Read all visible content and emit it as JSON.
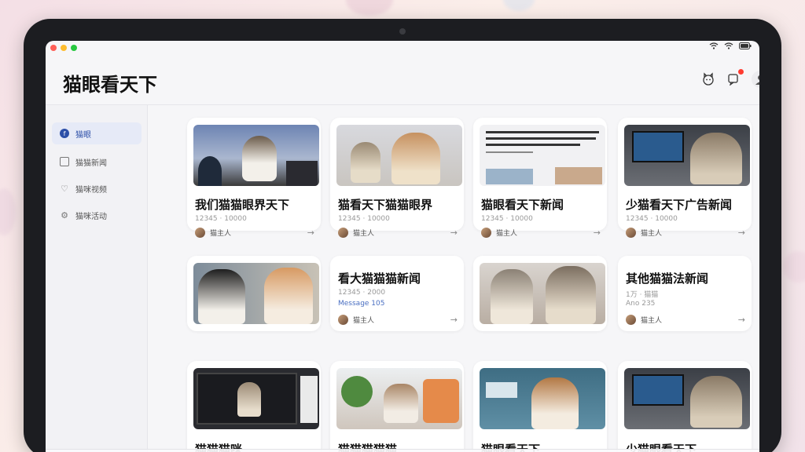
{
  "app": {
    "title": "猫眼看天下"
  },
  "colors": {
    "accent": "#2c4fa8",
    "badge": "#ff3b30",
    "close": "#ff5f57",
    "minimize": "#febc2e",
    "maximize": "#28c840"
  },
  "header_icons": [
    "cat-face-icon",
    "notification-icon",
    "user-avatar-icon"
  ],
  "status_bar": {
    "icons": [
      "wifi-icon",
      "wifi-icon",
      "battery-icon"
    ]
  },
  "sidebar": {
    "items": [
      {
        "label": "猫眼",
        "icon": "facebook-icon",
        "active": true
      },
      {
        "label": "猫猫新闻",
        "icon": "calendar-icon",
        "active": false
      },
      {
        "label": "猫咪视频",
        "icon": "heart-icon",
        "active": false
      },
      {
        "label": "猫咪活动",
        "icon": "settings-icon",
        "active": false
      }
    ]
  },
  "cards": [
    {
      "title": "我们猫猫眼界天下",
      "meta": "12345 · 10000",
      "author": "猫主人",
      "thumb": "cat-outdoor-house"
    },
    {
      "title": "猫看天下猫猫眼界",
      "meta": "12345 · 10000",
      "author": "猫主人",
      "thumb": "two-cats"
    },
    {
      "title": "猫眼看天下新闻",
      "meta": "12345 · 10000",
      "author": "猫主人",
      "thumb": "newspaper"
    },
    {
      "title": "少猫看天下广告新闻",
      "meta": "12345 · 10000",
      "author": "猫主人",
      "thumb": "cat-tv-room"
    },
    {
      "title": "",
      "meta": "",
      "author": "",
      "thumb": "black-white-ginger-cats"
    },
    {
      "title": "看大猫猫猫新闻",
      "meta": "12345 · 2000",
      "meta2": "Message 105",
      "author": "猫主人",
      "thumb": ""
    },
    {
      "title": "",
      "meta": "",
      "author": "",
      "thumb": "two-tabby-cats"
    },
    {
      "title": "其他猫猫法新闻",
      "meta": "1万 · 猫猫",
      "meta2": "Ano 235",
      "author": "猫主人",
      "thumb": ""
    },
    {
      "title": "猫猫猫咪",
      "meta": "",
      "author": "",
      "thumb": "cat-monitor"
    },
    {
      "title": "猫猫猫猫猫",
      "meta": "",
      "author": "",
      "thumb": "cat-desk"
    },
    {
      "title": "猫眼看天下",
      "meta": "",
      "author": "",
      "thumb": "cat-poster"
    },
    {
      "title": "少猫眼看天下",
      "meta": "",
      "author": "",
      "thumb": "cat-tv-room"
    }
  ],
  "dock": {
    "icons": [
      "home-icon",
      "search-icon",
      "gallery-icon",
      "hourglass-icon"
    ]
  }
}
